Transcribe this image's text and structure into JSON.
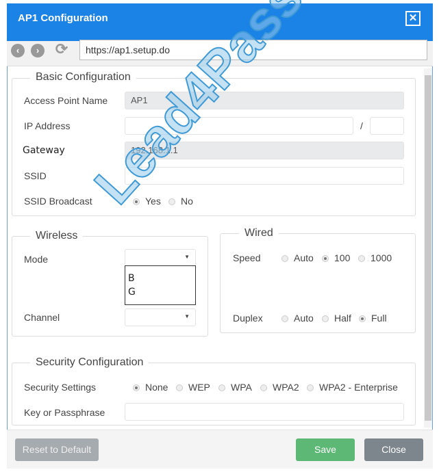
{
  "window": {
    "title": "AP1 Configuration",
    "close_icon": "close-icon"
  },
  "browser": {
    "url": "https://ap1.setup.do",
    "back_icon": "arrow-left-icon",
    "forward_icon": "arrow-right-icon",
    "refresh_icon": "refresh-icon"
  },
  "basic": {
    "legend": "Basic Configuration",
    "ap_name_label": "Access Point Name",
    "ap_name_value": "AP1",
    "ip_label": "IP Address",
    "ip_value": "",
    "slash": "/",
    "mask_value": "",
    "gateway_label": "Gateway",
    "gateway_value": "192.168.1.1",
    "ssid_label": "SSID",
    "ssid_value": "",
    "broadcast_label": "SSID Broadcast",
    "broadcast_options": [
      "Yes",
      "No"
    ],
    "broadcast_selected": "Yes"
  },
  "wireless": {
    "legend": "Wireless",
    "mode_label": "Mode",
    "mode_value": "",
    "mode_options": [
      "B",
      "G"
    ],
    "channel_label": "Channel",
    "channel_value": ""
  },
  "wired": {
    "legend": "Wired",
    "speed_label": "Speed",
    "speed_options": [
      "Auto",
      "100",
      "1000"
    ],
    "speed_selected": "100",
    "duplex_label": "Duplex",
    "duplex_options": [
      "Auto",
      "Half",
      "Full"
    ],
    "duplex_selected": "Full"
  },
  "security": {
    "legend": "Security Configuration",
    "settings_label": "Security Settings",
    "options": [
      "None",
      "WEP",
      "WPA",
      "WPA2",
      "WPA2 - Enterprise"
    ],
    "selected": "None",
    "key_label": "Key or Passphrase",
    "key_value": ""
  },
  "footer": {
    "reset": "Reset to Default",
    "save": "Save",
    "close": "Close"
  },
  "colors": {
    "titlebar": "#1b82e6",
    "save": "#5cb874",
    "close": "#7d858d",
    "reset": "#a6abb0"
  },
  "watermark": "Lead4Pass"
}
